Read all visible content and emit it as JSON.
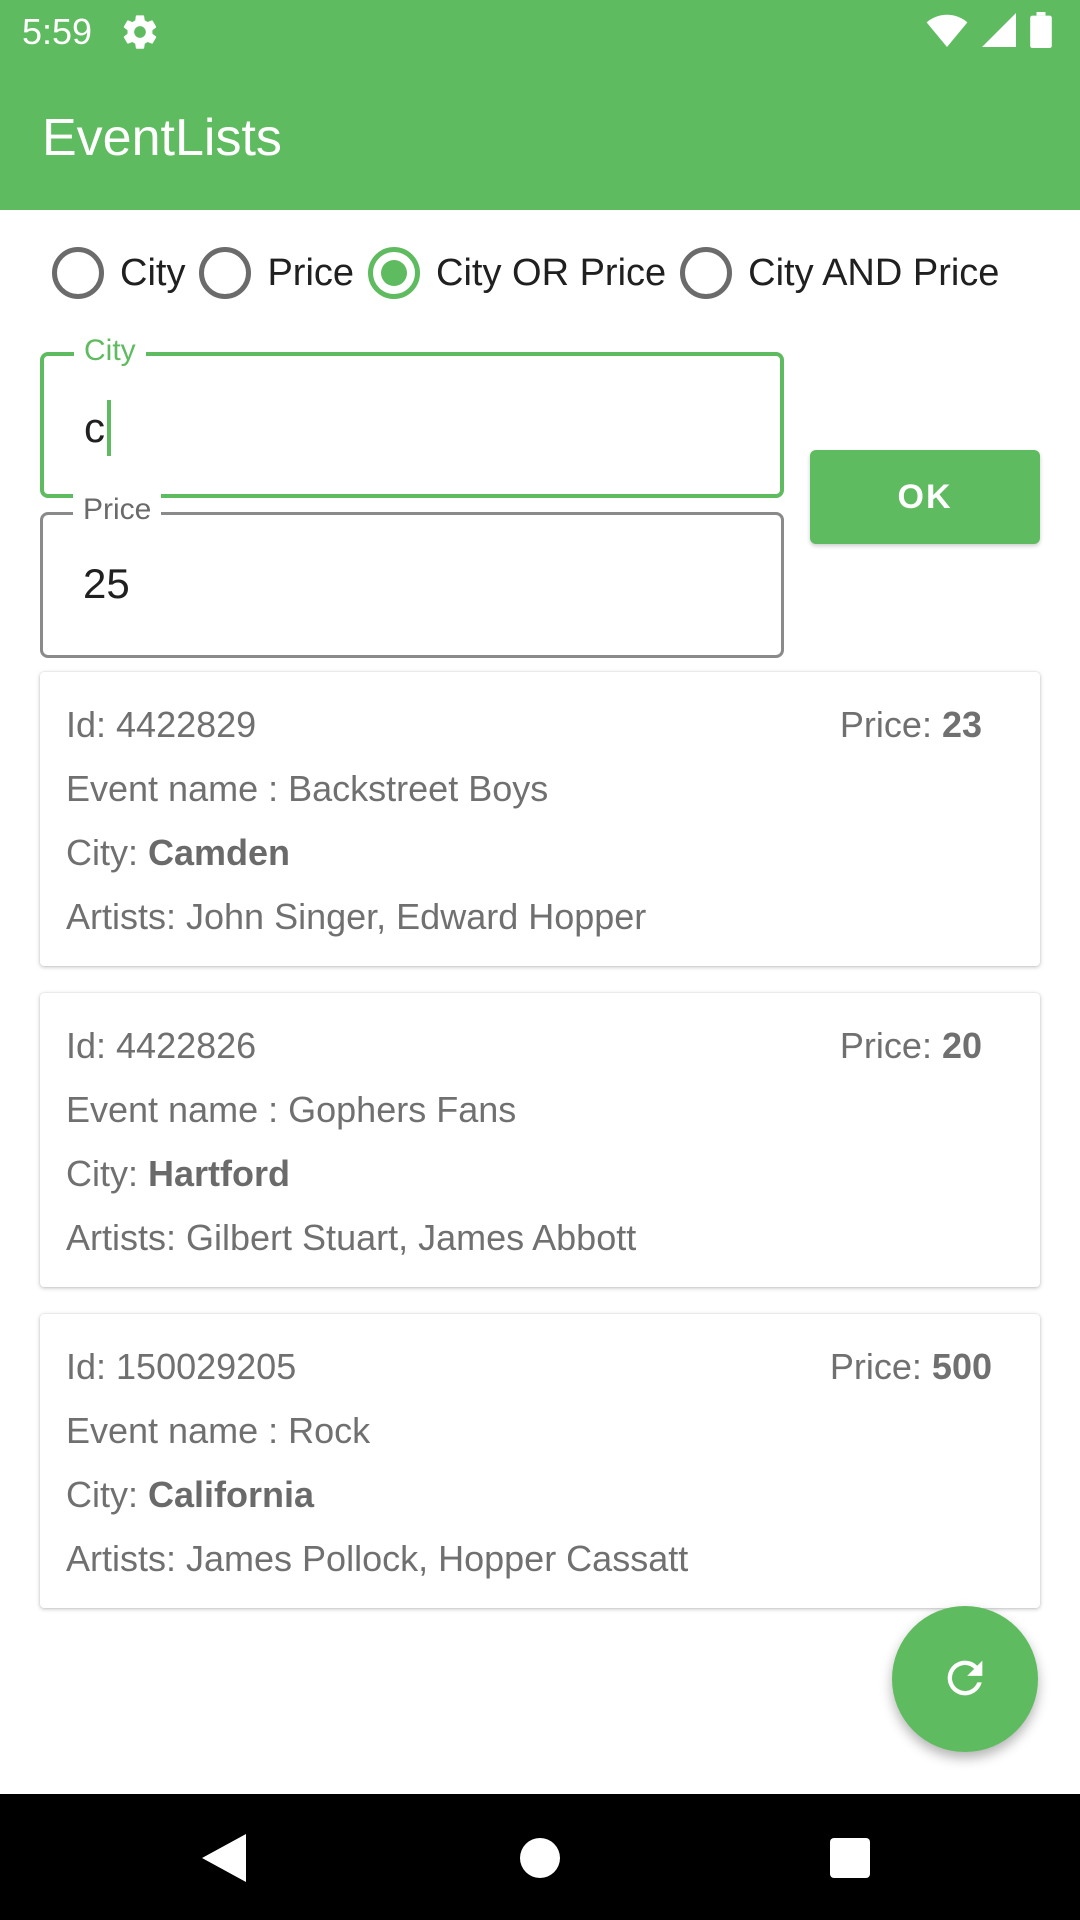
{
  "status_bar": {
    "time": "5:59",
    "icons": [
      "gear-icon",
      "wifi-icon",
      "signal-icon",
      "battery-icon"
    ]
  },
  "app": {
    "title": "EventLists",
    "accent_color": "#5fbb5f"
  },
  "filter_options": [
    {
      "label": "City",
      "checked": false
    },
    {
      "label": "Price",
      "checked": false
    },
    {
      "label": "City OR Price",
      "checked": true
    },
    {
      "label": "City AND Price",
      "checked": false
    }
  ],
  "city_field": {
    "label": "City",
    "value": "c"
  },
  "price_field": {
    "label": "Price",
    "value": "25"
  },
  "ok_button": {
    "label": "OK"
  },
  "events": [
    {
      "id_label": "Id: ",
      "id": "4422829",
      "price_label": "Price: ",
      "price": "23",
      "name_label": "Event name : ",
      "name": "Backstreet Boys",
      "city_label": "City: ",
      "city": "Camden",
      "artists_label": "Artists: ",
      "artists": "John Singer, Edward Hopper"
    },
    {
      "id_label": "Id: ",
      "id": "4422826",
      "price_label": "Price: ",
      "price": "20",
      "name_label": "Event name : ",
      "name": "Gophers Fans",
      "city_label": "City: ",
      "city": "Hartford",
      "artists_label": "Artists: ",
      "artists": "Gilbert Stuart, James Abbott"
    },
    {
      "id_label": "Id: ",
      "id": "150029205",
      "price_label": "Price: ",
      "price": "500",
      "name_label": "Event name : ",
      "name": "Rock",
      "city_label": "City: ",
      "city": "California",
      "artists_label": "Artists: ",
      "artists": "James Pollock, Hopper Cassatt"
    }
  ],
  "fab": {
    "icon": "refresh-icon"
  },
  "nav_bar": {
    "icons": [
      "back-icon",
      "home-icon",
      "recents-icon"
    ]
  }
}
